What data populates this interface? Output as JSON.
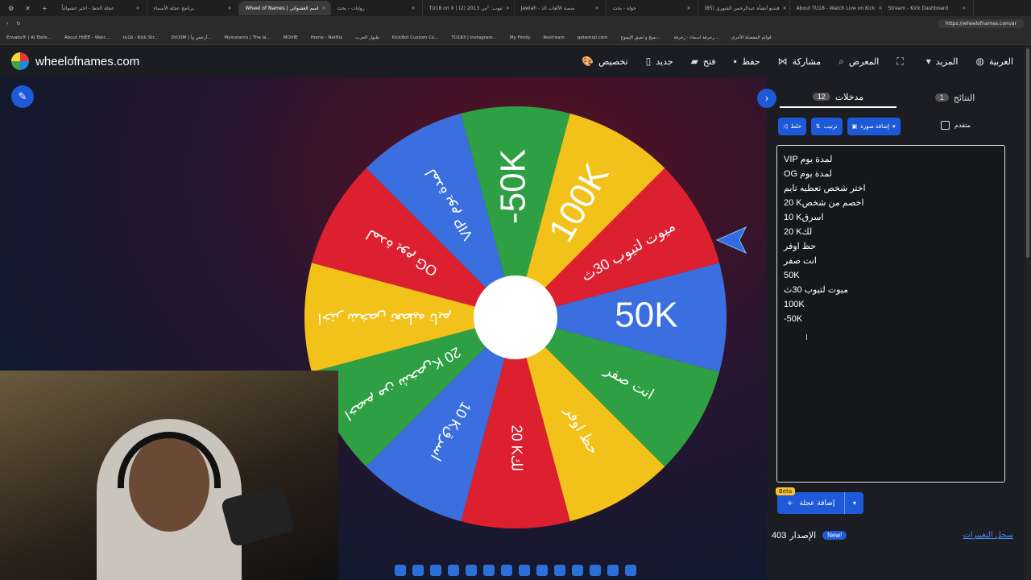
{
  "browser": {
    "tabs": [
      {
        "label": "عجلة الحظ - اختر عشوائياً"
      },
      {
        "label": "برنامج عجلة الأسماء"
      },
      {
        "label": "Wheel of Names | اسم العشوائي",
        "active": true
      },
      {
        "label": "روايات - بحث"
      },
      {
        "label": "TU18 on X | (2) تيوب: \"من 2013"
      },
      {
        "label": "Jawlah - منصة الألعاب الذ"
      },
      {
        "label": "جولة - بحث"
      },
      {
        "label": "(85) فيديو أنشأه عبدالرحمن الشهري"
      },
      {
        "label": "About TU18 - Watch Live on Kick"
      },
      {
        "label": "Stream - Kick Dashboard"
      }
    ],
    "url": "https://wheelofnames.com/ar",
    "bookmarks": [
      "Envato® | AI Tools...",
      "About HIIEE - Watc...",
      "tu1b - Kick Str...",
      "DrO3M | أرخص وأ...",
      "Myinstants | The la...",
      "MOVIE",
      "Home - Netflix",
      "طبول الحرب",
      "KickBot Custom Co...",
      "TU183 | Instagram...",
      "My Fimily",
      "Restream",
      "getemoji.com",
      "نسخ و لصق الإيموج...",
      "زخرفة اسماء - زخرفة...",
      "قوائم المفضلة الأخرى"
    ]
  },
  "header": {
    "site_name": "wheelofnames.com",
    "menu": [
      {
        "label": "تخصيص",
        "icon": "palette-icon"
      },
      {
        "label": "جديد",
        "icon": "file-icon"
      },
      {
        "label": "فتح",
        "icon": "folder-icon"
      },
      {
        "label": "حفظ",
        "icon": "save-icon"
      },
      {
        "label": "مشاركة",
        "icon": "share-icon"
      },
      {
        "label": "المعرض",
        "icon": "search-icon"
      },
      {
        "label": "",
        "icon": "fullscreen-icon"
      },
      {
        "label": "المزيد",
        "icon": "chevron-down-icon"
      },
      {
        "label": "العربية",
        "icon": "globe-icon"
      }
    ]
  },
  "wheel": {
    "colors": {
      "red": "#dd2030",
      "blue": "#3b6fe0",
      "green": "#2ea043",
      "yellow": "#f2c21b"
    },
    "segments": [
      {
        "label": "50K",
        "color": "#3b6fe0"
      },
      {
        "label": "انت صفر",
        "color": "#2ea043"
      },
      {
        "label": "حظ اوفر",
        "color": "#f2c21b"
      },
      {
        "label": "20 Kلك",
        "color": "#dd2030"
      },
      {
        "label": "10 Kاسرق",
        "color": "#3b6fe0"
      },
      {
        "label": "20 Kاخصم من شخص",
        "color": "#2ea043"
      },
      {
        "label": "اختر شخص تعطيه تايم",
        "color": "#f2c21b"
      },
      {
        "label": "OG لمدة يوم",
        "color": "#dd2030"
      },
      {
        "label": "VIP لمدة يوم",
        "color": "#3b6fe0"
      },
      {
        "label": "-50K",
        "color": "#2ea043"
      },
      {
        "label": "100K",
        "color": "#f2c21b"
      },
      {
        "label": "ميوت لتيوب 30ث",
        "color": "#dd2030"
      }
    ]
  },
  "panel": {
    "tab_entries": "مدخلات",
    "entries_count": "12",
    "tab_results": "النتائج",
    "results_count": "1",
    "tools": {
      "shuffle": "خلط",
      "sort": "ترتيب",
      "add_image": "إضافة صورة"
    },
    "advanced": "متقدم",
    "entries": [
      "VIP لمدة يوم",
      "OG لمدة يوم",
      "اختر شخص تعطيه تايم",
      "20 Kاخصم من شخص",
      "10 Kاسرق",
      "20 Kلك",
      "حظ اوفر",
      "انت صفر",
      " 50K",
      "ميوت لتيوب 30ث",
      "100K",
      "-50K"
    ],
    "add_wheel": "إضافة عجلة",
    "beta": "Beta",
    "version_label": "الإصدار",
    "version": "403",
    "new_badge": "New!",
    "changelog": "سجل التغييرات"
  }
}
